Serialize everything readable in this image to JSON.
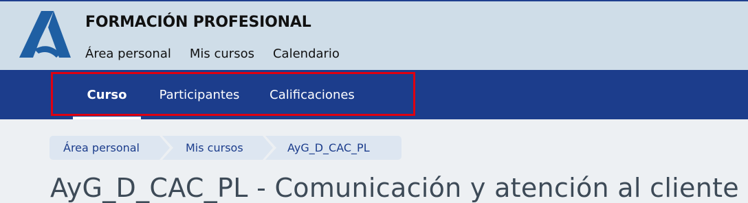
{
  "header": {
    "site_title": "FORMACIÓN PROFESIONAL",
    "logo_icon": "andalucia-a-logo",
    "nav": [
      "Área personal",
      "Mis cursos",
      "Calendario"
    ]
  },
  "course_nav": {
    "tabs": [
      {
        "label": "Curso",
        "active": true
      },
      {
        "label": "Participantes",
        "active": false
      },
      {
        "label": "Calificaciones",
        "active": false
      }
    ]
  },
  "breadcrumb": [
    "Área personal",
    "Mis cursos",
    "AyG_D_CAC_PL"
  ],
  "page_title": "AyG_D_CAC_PL - Comunicación y atención al cliente",
  "colors": {
    "header_bg": "#cfdde8",
    "course_bar_bg": "#1c3d8c",
    "logo_blue": "#1f5fa3",
    "highlight_border": "#e00010",
    "breadcrumb_bg": "#dde6f1"
  }
}
